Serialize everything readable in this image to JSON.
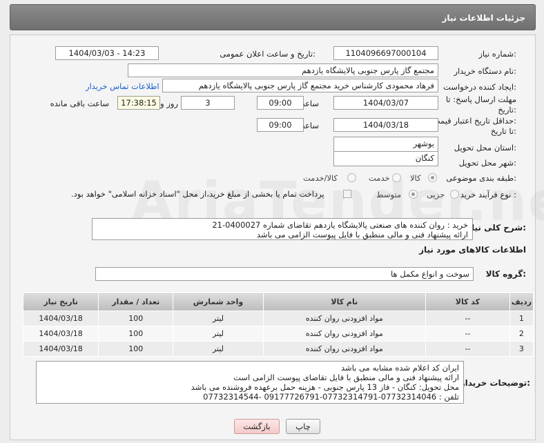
{
  "header": {
    "title": "جزئیات اطلاعات نیاز"
  },
  "form": {
    "need_number": {
      "label": "شماره نیاز:",
      "value": "1104096697000104"
    },
    "announce": {
      "label": "تاریخ و ساعت اعلان عمومی:",
      "value": "1404/03/03 - 14:23"
    },
    "buyer_org": {
      "label": "نام دستگاه خریدار:",
      "value": "مجتمع گاز پارس جنوبی  پالایشگاه یازدهم"
    },
    "requester": {
      "label": "ایجاد کننده درخواست:",
      "value": "فرهاد محمودی کارشناس خرید مجتمع گاز پارس جنوبی  پالایشگاه یازدهم",
      "contact_link": "اطلاعات تماس خریدار"
    },
    "reply_deadline": {
      "label_line1": "مهلت ارسال پاسخ: تا",
      "label_line2": "تاریخ:",
      "date": "1404/03/07",
      "time_label": "ساعت",
      "time": "09:00",
      "days": "3",
      "days_label": "روز و",
      "remaining": "17:38:15",
      "remaining_label": "ساعت باقی مانده"
    },
    "price_validity": {
      "label_line1": "حداقل تاریخ اعتبار قیمت:",
      "label_line2": "تا تاریخ:",
      "date": "1404/03/18",
      "time_label": "ساعت",
      "time": "09:00"
    },
    "province": {
      "label": "استان محل تحویل:",
      "value": "بوشهر"
    },
    "city": {
      "label": "شهر محل تحویل:",
      "value": "کنگان"
    },
    "category": {
      "label": "طبقه بندی موضوعی:",
      "options": [
        "کالا",
        "خدمت",
        "کالا/خدمت"
      ],
      "selected": "کالا"
    },
    "process": {
      "label": "نوع فرآیند خرید :",
      "options": [
        "جزیی",
        "متوسط"
      ],
      "selected": "متوسط",
      "note": "پرداخت تمام یا بخشی از مبلغ خرید،از محل \"اسناد خزانه اسلامی\" خواهد بود."
    },
    "description": {
      "label": "شرح کلی نیاز:",
      "line1": "خرید :  روان کننده های صنعتی پالایشگاه یازدهم تقاضای شماره 0400027-21",
      "line2": "ارائه پیشنهاد فنی و مالی منطبق با فایل پیوست الزامی می باشد"
    }
  },
  "goods": {
    "section_title": "اطلاعات کالاهای مورد نیاز",
    "group_label": "گروه کالا:",
    "group_value": "سوخت و انواع مکمل ها",
    "columns": [
      "ردیف",
      "کد کالا",
      "نام کالا",
      "واحد شمارش",
      "تعداد / مقدار",
      "تاریخ نیاز"
    ],
    "rows": [
      {
        "idx": "1",
        "code": "--",
        "name": "مواد افزودنی روان کننده",
        "unit": "لیتر",
        "qty": "100",
        "date": "1404/03/18"
      },
      {
        "idx": "2",
        "code": "--",
        "name": "مواد افزودنی روان کننده",
        "unit": "لیتر",
        "qty": "100",
        "date": "1404/03/18"
      },
      {
        "idx": "3",
        "code": "--",
        "name": "مواد افزودنی روان کننده",
        "unit": "لیتر",
        "qty": "100",
        "date": "1404/03/18"
      }
    ]
  },
  "buyer_notes": {
    "label": "توضیحات خریدار:",
    "lines": [
      "ایران کد اعلام شده مشابه می باشد",
      " ارائه پیشنهاد فنی و مالی منطبق با فایل تقاضای پیوست الزامی است",
      "محل تحویل: کنگان - فاز 13 پارس جنوبی - هزینه حمل برعهده فروشنده می باشد",
      "تلفن : 07732314046-07732314791-09177726791 -07732314544"
    ]
  },
  "buttons": {
    "print": "چاپ",
    "back": "بازگشت"
  },
  "watermark": "AriaTender.neT"
}
